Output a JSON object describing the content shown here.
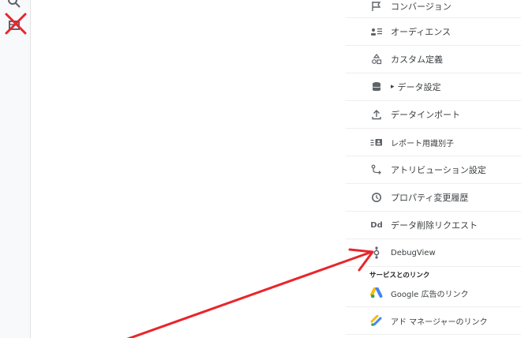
{
  "admin_menu": {
    "items": [
      {
        "label": "コンバージョン",
        "icon": "flag-icon"
      },
      {
        "label": "オーディエンス",
        "icon": "audience-icon"
      },
      {
        "label": "カスタム定義",
        "icon": "shapes-icon"
      },
      {
        "label": "データ設定",
        "icon": "database-icon",
        "expand_glyph": "▸"
      },
      {
        "label": "データインポート",
        "icon": "upload-icon"
      },
      {
        "label": "レポート用識別子",
        "icon": "identifier-icon"
      },
      {
        "label": "アトリビューション設定",
        "icon": "attribution-icon"
      },
      {
        "label": "プロパティ変更履歴",
        "icon": "history-icon"
      },
      {
        "label": "データ削除リクエスト",
        "icon": "dd-icon",
        "icon_text": "Dd"
      },
      {
        "label": "DebugView",
        "icon": "debugview-icon"
      }
    ],
    "section_links": {
      "header": "サービスとのリンク",
      "items": [
        {
          "label": "Google 広告のリンク",
          "icon": "google-ads-icon"
        },
        {
          "label": "アド マネージャーのリンク",
          "icon": "ad-manager-icon"
        }
      ]
    }
  },
  "annotation": {
    "arrow_color": "#e8262b",
    "cross_color": "#e8262b"
  },
  "colors": {
    "text": "#3c4043",
    "icon": "#5f6368",
    "divider": "#eeeeee"
  }
}
